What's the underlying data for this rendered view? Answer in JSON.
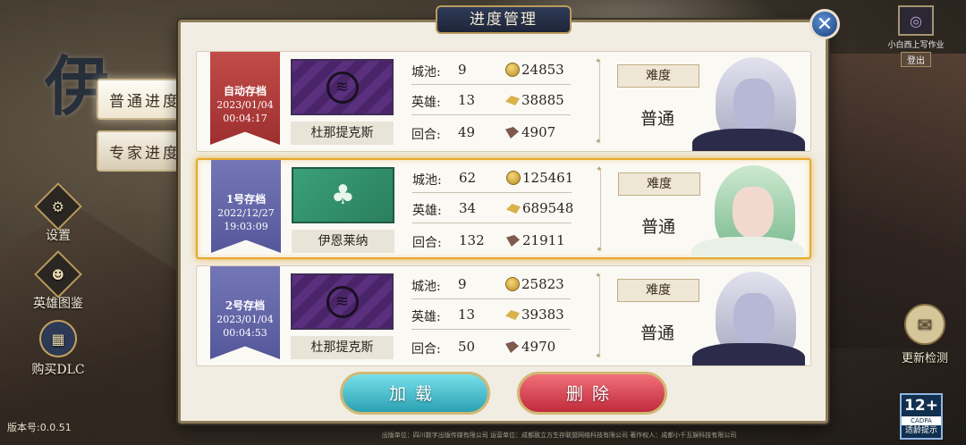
{
  "panel": {
    "title": "进度管理"
  },
  "left_tabs": [
    {
      "label": "普通进度"
    },
    {
      "label": "专家进度"
    }
  ],
  "side_buttons": [
    {
      "label": "设置",
      "icon": "gear-icon"
    },
    {
      "label": "英雄图鉴",
      "icon": "portrait-icon"
    },
    {
      "label": "购买DLC",
      "icon": "treasure-icon"
    }
  ],
  "top_right": {
    "label": "小白西上写作业",
    "sub": "登出"
  },
  "update": {
    "label": "更新检测"
  },
  "age_rating": {
    "number": "12+",
    "org": "CADPA",
    "text": "适龄提示"
  },
  "version": "版本号:0.0.51",
  "footer": "出版单位：四川数字出版传媒有限公司  运营单位：成都赦立方生存联盟网络科技有限公司  著作权人：成都小千互娱科技有限公司",
  "labels": {
    "cities": "城池:",
    "heroes": "英雄:",
    "turns": "回合:",
    "difficulty": "难度"
  },
  "slots": [
    {
      "name": "自动存档",
      "date": "2023/01/04",
      "time": "00:04:17",
      "ribbon_color": "#b43c3a",
      "hero": "杜那提克斯",
      "cities": "9",
      "heroes": "13",
      "turns": "49",
      "gold": "24853",
      "food": "38885",
      "wood": "4907",
      "difficulty": "普通",
      "selected": false
    },
    {
      "name": "1号存档",
      "date": "2022/12/27",
      "time": "19:03:09",
      "ribbon_color": "#6467aa",
      "hero": "伊恩莱纳",
      "cities": "62",
      "heroes": "34",
      "turns": "132",
      "gold": "125461",
      "food": "689548",
      "wood": "21911",
      "difficulty": "普通",
      "selected": true
    },
    {
      "name": "2号存档",
      "date": "2023/01/04",
      "time": "00:04:53",
      "ribbon_color": "#6467aa",
      "hero": "杜那提克斯",
      "cities": "9",
      "heroes": "13",
      "turns": "50",
      "gold": "25823",
      "food": "39383",
      "wood": "4970",
      "difficulty": "普通",
      "selected": false
    }
  ],
  "buttons": {
    "load": "加载",
    "delete": "删除"
  },
  "colors": {
    "accent_gold": "#e6a92c",
    "load_button": "#2aa1b3",
    "delete_button": "#c02b3c",
    "panel_title_bg": "#1d2538"
  }
}
